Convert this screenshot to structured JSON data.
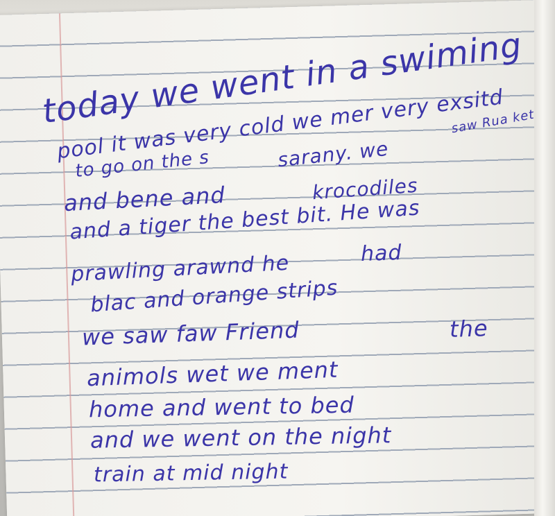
{
  "notebook": {
    "ink_color": "#3b35a8",
    "line_color": "#9fa9b8",
    "margin_color": "#d99a9a",
    "paper_color": "#f3f2ee"
  },
  "handwriting": {
    "line1": "today we went in a swiming",
    "line2": "pool it was very cold we mer very exsitd",
    "line2_above": "saw Rua ket",
    "line3_a": "to go on the s",
    "line3_b": "sarany. we",
    "line4_a": "and bene and",
    "line4_b": "krocodiles",
    "line5_a": "and a tiger the best bit. He was",
    "line6_a": "prawling arawnd he",
    "line6_b": "had",
    "line7": "blac and orange strips",
    "line8_a": "we saw faw Friend",
    "line8_b": "the",
    "line9": "animols wet we ment",
    "line10": "home and went to bed",
    "line11": "and we went on the night",
    "line12": "train at mid night"
  }
}
